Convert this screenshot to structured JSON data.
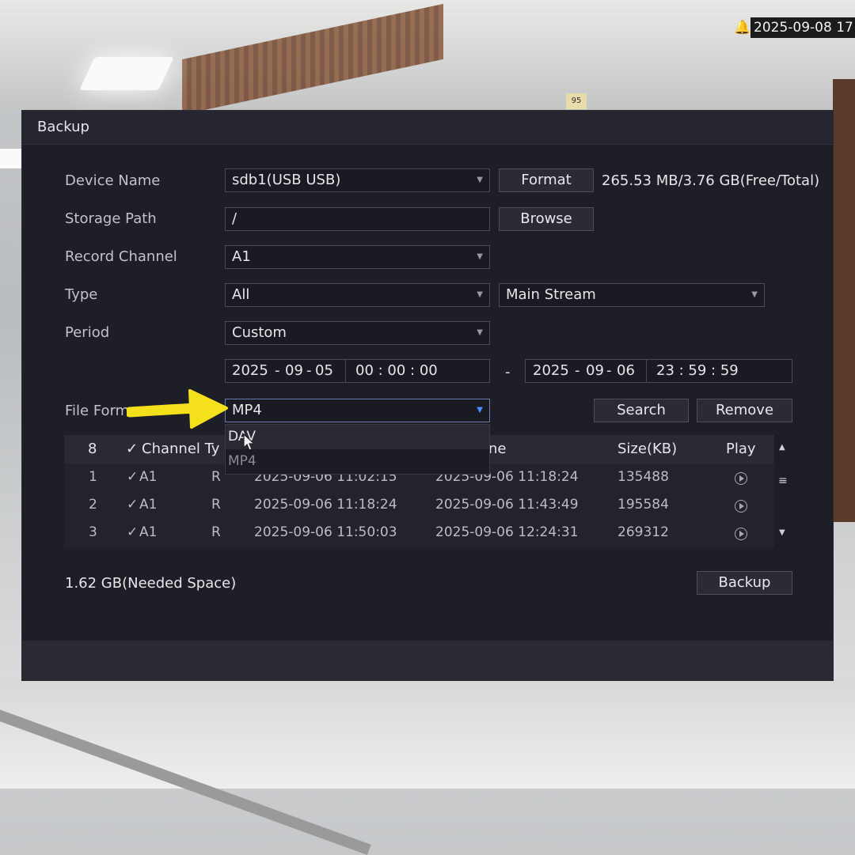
{
  "osd": {
    "datetime": "2025-09-08 17",
    "alarm_icon": "bell-icon"
  },
  "dialog": {
    "title": "Backup"
  },
  "form": {
    "device_name": {
      "label": "Device Name",
      "value": "sdb1(USB USB)",
      "button": "Format",
      "capacity": "265.53 MB/3.76 GB(Free/Total)"
    },
    "storage_path": {
      "label": "Storage Path",
      "value": "/",
      "button": "Browse"
    },
    "record_channel": {
      "label": "Record Channel",
      "value": "A1"
    },
    "type": {
      "label": "Type",
      "value": "All",
      "stream": "Main Stream"
    },
    "period": {
      "label": "Period",
      "value": "Custom",
      "start": {
        "year": "2025",
        "month": "09",
        "day": "05",
        "time": "00 : 00 : 00"
      },
      "separator": "-",
      "end": {
        "year": "2025",
        "month": "09",
        "day": "06",
        "time": "23 : 59 : 59"
      }
    },
    "file_format": {
      "label": "File Form",
      "value": "MP4",
      "options": [
        "DAV",
        "MP4"
      ]
    },
    "search_button": "Search",
    "remove_button": "Remove"
  },
  "table": {
    "headers": {
      "count": "8",
      "channel_type": "Channel Ty",
      "end_time": "ne",
      "size": "Size(KB)",
      "play": "Play"
    },
    "rows": [
      {
        "index": "1",
        "channel": "A1",
        "type": "R",
        "start": "2025-09-06 11:02:15",
        "end": "2025-09-06 11:18:24",
        "size": "135488"
      },
      {
        "index": "2",
        "channel": "A1",
        "type": "R",
        "start": "2025-09-06 11:18:24",
        "end": "2025-09-06 11:43:49",
        "size": "195584"
      },
      {
        "index": "3",
        "channel": "A1",
        "type": "R",
        "start": "2025-09-06 11:50:03",
        "end": "2025-09-06 12:24:31",
        "size": "269312"
      }
    ],
    "check_mark": "✓"
  },
  "footer": {
    "needed_space": "1.62 GB(Needed Space)",
    "backup_button": "Backup"
  },
  "colors": {
    "annotation_arrow": "#f5e11b",
    "dialog_bg": "#1e1e27",
    "active_arrow": "#4a90ff"
  }
}
